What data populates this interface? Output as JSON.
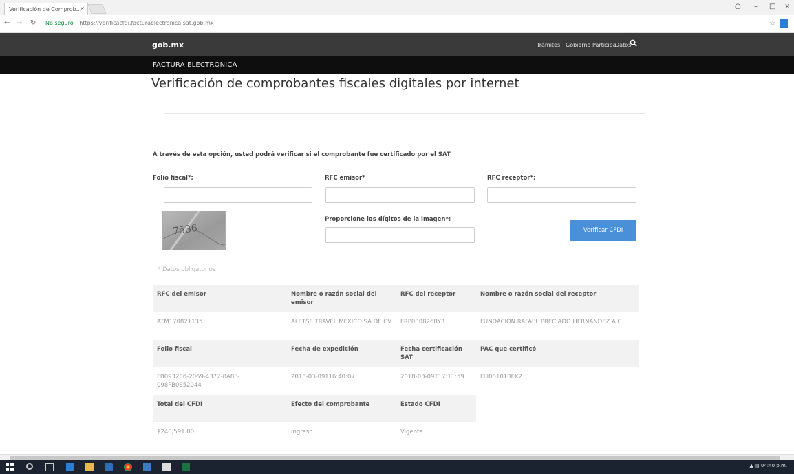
{
  "browser": {
    "tab_title": "Verificación de Comprob...",
    "tab_close": "×",
    "url_secure": "No seguro",
    "url": "https://verificacfdi.facturaelectronica.sat.gob.mx"
  },
  "site": {
    "logo": "gob.mx",
    "nav": [
      "Trámites",
      "Gobierno",
      "Participa",
      "Datos"
    ],
    "section": "FACTURA ELECTRÓNICA"
  },
  "page": {
    "title": "Verificación de comprobantes fiscales digitales por internet",
    "intro": "A través de esta opción, usted podrá verificar si el comprobante fue certificado por el SAT"
  },
  "form": {
    "folio_label": "Folio fiscal*:",
    "rfc_emisor_label": "RFC emisor*",
    "rfc_receptor_label": "RFC receptor*:",
    "captcha_label": "Proporcione los dígitos de la imagen*:",
    "captcha_text": "7536",
    "verify_button": "Verificar CFDI",
    "required_note": "* Datos obligatorios"
  },
  "results": {
    "row1_headers": [
      "RFC del emisor",
      "Nombre o razón social del emisor",
      "RFC del receptor",
      "Nombre o razón social del receptor"
    ],
    "row1_values": [
      "ATM170821135",
      "ALETSE TRAVEL MEXICO SA DE CV",
      "FRP030826RY3",
      "FUNDACION RAFAEL PRECIADO HERNANDEZ A.C."
    ],
    "row2_headers": [
      "Folio fiscal",
      "Fecha de expedición",
      "Fecha certificación SAT",
      "PAC que certificó"
    ],
    "row2_values": [
      "FB093206-2069-4377-8A8F-098FB0E52044",
      "2018-03-09T16:40:07",
      "2018-03-09T17:11:59",
      "FLI081010EK2"
    ],
    "row3_headers": [
      "Total del CFDI",
      "Efecto del comprobante",
      "Estado CFDI"
    ],
    "row3_values": [
      "$240,591.00",
      "Ingreso",
      "Vigente"
    ]
  },
  "taskbar": {
    "clock": "04:40 p.m."
  }
}
